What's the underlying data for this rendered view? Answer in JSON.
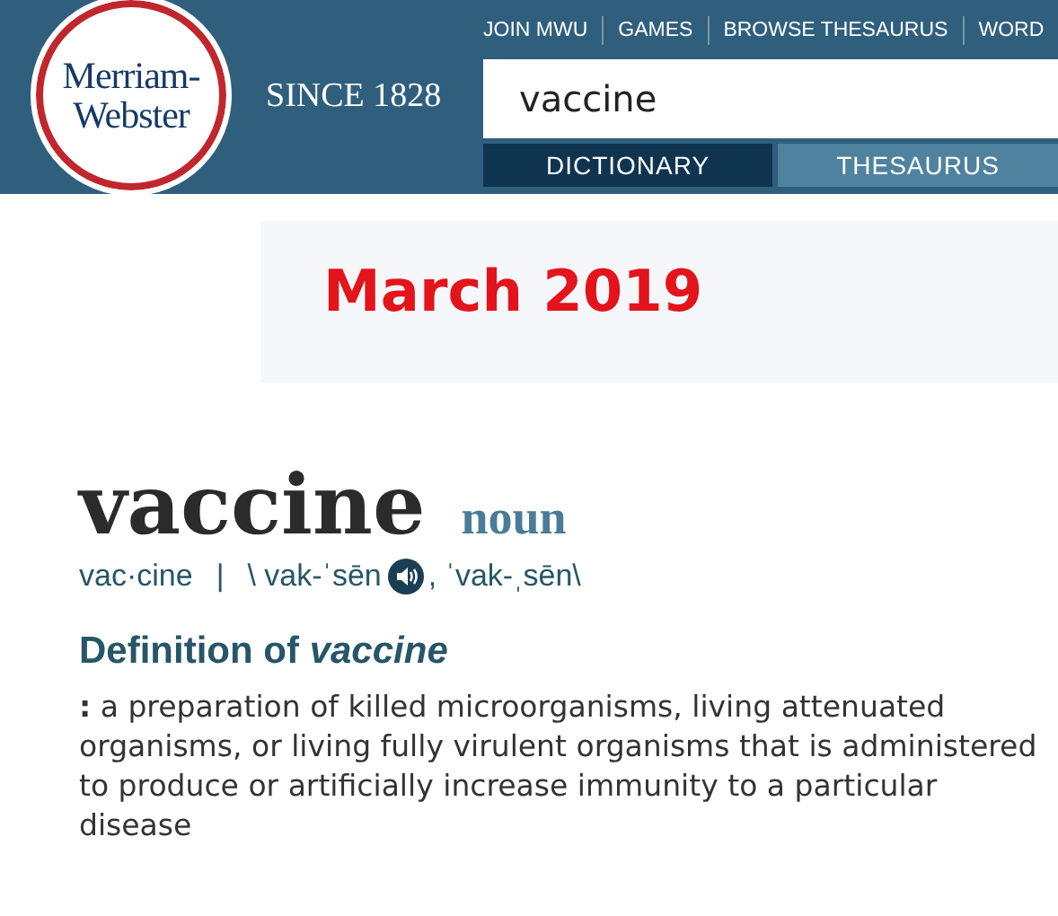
{
  "header": {
    "logo": [
      "Merriam-",
      "Webster"
    ],
    "tagline": "SINCE 1828",
    "nav": [
      "JOIN MWU",
      "GAMES",
      "BROWSE THESAURUS",
      "WORD"
    ],
    "search": {
      "value": "vaccine"
    },
    "tabs": [
      {
        "label": "DICTIONARY",
        "selected": true
      },
      {
        "label": "THESAURUS",
        "selected": false
      }
    ]
  },
  "note": "March 2019",
  "entry": {
    "headword": "vaccine",
    "part_of_speech": "noun",
    "syllables": "vac·cine",
    "separator": "|",
    "pronunciation_1": "\\ vak-ˈsēn",
    "pronunciation_2": ", ˈvak-ˌsēn\\",
    "definition_heading": "Definition of *vaccine*",
    "definition": "**:** a preparation of killed microorganisms, living attenuated organisms, or living fully virulent organisms that is administered to produce or artificially increase immunity to a particular disease"
  }
}
